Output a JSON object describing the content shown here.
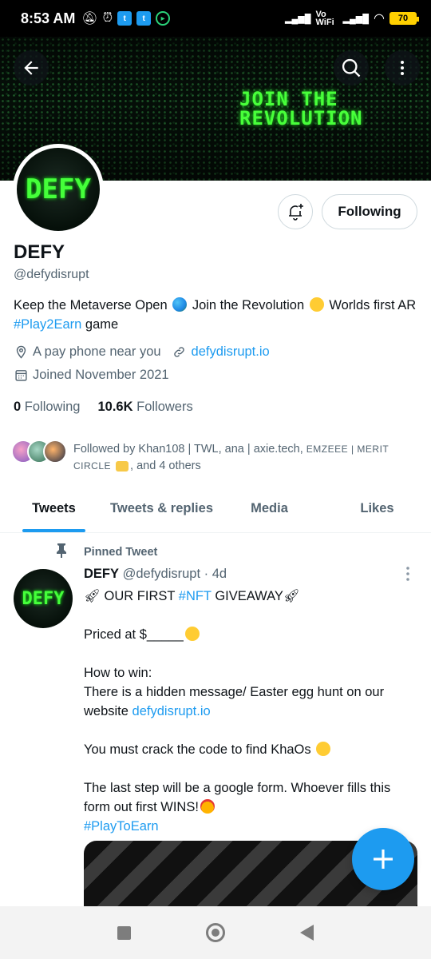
{
  "status_bar": {
    "time": "8:53 AM",
    "battery": "70",
    "network": "Vo WiFi"
  },
  "banner": {
    "text": "JOIN THE REVOLUTION",
    "accent_color": "#48ff3a"
  },
  "profile": {
    "avatar_text": "DEFY",
    "following_button": "Following",
    "name": "DEFY",
    "handle": "@defydisrupt",
    "bio_part1": "Keep the Metaverse Open",
    "bio_part2": "Join the Revolution",
    "bio_part3": "Worlds first AR",
    "bio_hashtag": "#Play2Earn",
    "bio_part4": "game",
    "location": "A pay phone near you",
    "website": "defydisrupt.io",
    "joined": "Joined November 2021",
    "following_count": "0",
    "following_label": "Following",
    "followers_count": "10.6K",
    "followers_label": "Followers",
    "followed_by_prefix": "Followed by Khan108 | TWL, ana | axie.tech,",
    "followed_by_caps1": "EMZEEE | MERIT",
    "followed_by_caps2": "CIRCLE",
    "followed_by_suffix": ", and 4 others"
  },
  "tabs": [
    {
      "label": "Tweets",
      "active": true
    },
    {
      "label": "Tweets & replies",
      "active": false
    },
    {
      "label": "Media",
      "active": false
    },
    {
      "label": "Likes",
      "active": false
    }
  ],
  "tweet": {
    "pinned_label": "Pinned Tweet",
    "avatar_text": "DEFY",
    "author": "DEFY",
    "handle": "@defydisrupt",
    "time": "· 4d",
    "line1_a": "OUR FIRST",
    "line1_tag": "#NFT",
    "line1_b": "GIVEAWAY",
    "line2": "Priced at $_____",
    "line3": "How to win:",
    "line4": "There is a hidden message/ Easter egg hunt on our website",
    "line4_link": "defydisrupt.io",
    "line5": "You must crack the code to find KhaOs",
    "line6": "The last step will be a google form. Whoever fills this form out first WINS!",
    "hashtag": "#PlayToEarn"
  },
  "icons": {
    "back": "arrow-left-icon",
    "search": "search-icon",
    "more": "more-vertical-icon",
    "bell": "bell-plus-icon",
    "location": "location-pin-icon",
    "link": "link-icon",
    "calendar": "calendar-icon",
    "pin": "pin-icon",
    "compose": "plus-icon"
  }
}
